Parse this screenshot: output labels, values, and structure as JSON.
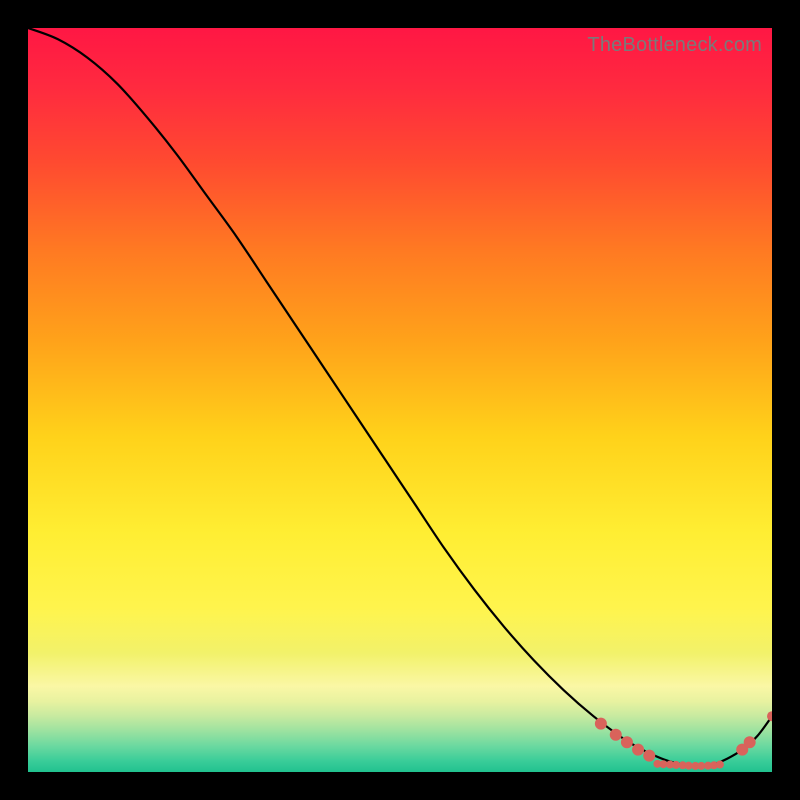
{
  "watermark": "TheBottleneck.com",
  "chart_data": {
    "type": "line",
    "title": "",
    "xlabel": "",
    "ylabel": "",
    "xlim": [
      0,
      100
    ],
    "ylim": [
      0,
      100
    ],
    "grid": false,
    "axes_visible": false,
    "series": [
      {
        "name": "curve",
        "color": "#000000",
        "x": [
          0,
          4,
          8,
          12,
          16,
          20,
          24,
          28,
          32,
          36,
          40,
          44,
          48,
          52,
          56,
          60,
          64,
          68,
          72,
          76,
          80,
          82,
          84,
          86,
          88,
          90,
          92,
          94,
          96,
          98,
          100
        ],
        "y": [
          100,
          98.5,
          96,
          92.5,
          88,
          83,
          77.5,
          72,
          66,
          60,
          54,
          48,
          42,
          36,
          30,
          24.5,
          19.5,
          15,
          11,
          7.5,
          4.5,
          3.3,
          2.3,
          1.5,
          1.0,
          0.8,
          1.0,
          1.8,
          3.0,
          4.8,
          7.5
        ]
      }
    ],
    "markers": [
      {
        "x": 77,
        "y": 6.5,
        "r": 6,
        "color": "#d9635b"
      },
      {
        "x": 79,
        "y": 5.0,
        "r": 6,
        "color": "#d9635b"
      },
      {
        "x": 80.5,
        "y": 4.0,
        "r": 6,
        "color": "#d9635b"
      },
      {
        "x": 82,
        "y": 3.0,
        "r": 6,
        "color": "#d9635b"
      },
      {
        "x": 83.5,
        "y": 2.2,
        "r": 6,
        "color": "#d9635b"
      },
      {
        "x": 84.6,
        "y": 1.1,
        "r": 4,
        "color": "#d9635b"
      },
      {
        "x": 85.4,
        "y": 1.05,
        "r": 4,
        "color": "#d9635b"
      },
      {
        "x": 86.3,
        "y": 1.0,
        "r": 4,
        "color": "#d9635b"
      },
      {
        "x": 87.1,
        "y": 0.95,
        "r": 4,
        "color": "#d9635b"
      },
      {
        "x": 88.0,
        "y": 0.9,
        "r": 4,
        "color": "#d9635b"
      },
      {
        "x": 88.8,
        "y": 0.85,
        "r": 4,
        "color": "#d9635b"
      },
      {
        "x": 89.7,
        "y": 0.82,
        "r": 4,
        "color": "#d9635b"
      },
      {
        "x": 90.5,
        "y": 0.82,
        "r": 4,
        "color": "#d9635b"
      },
      {
        "x": 91.4,
        "y": 0.85,
        "r": 4,
        "color": "#d9635b"
      },
      {
        "x": 92.2,
        "y": 0.9,
        "r": 4,
        "color": "#d9635b"
      },
      {
        "x": 93.0,
        "y": 1.0,
        "r": 4,
        "color": "#d9635b"
      },
      {
        "x": 96.0,
        "y": 3.0,
        "r": 6,
        "color": "#d9635b"
      },
      {
        "x": 97.0,
        "y": 4.0,
        "r": 6,
        "color": "#d9635b"
      },
      {
        "x": 100.0,
        "y": 7.5,
        "r": 5,
        "color": "#d9635b"
      }
    ],
    "gradient_stops": [
      {
        "offset": 0.0,
        "color": "#ff1744"
      },
      {
        "offset": 0.08,
        "color": "#ff2a3f"
      },
      {
        "offset": 0.18,
        "color": "#ff4a30"
      },
      {
        "offset": 0.3,
        "color": "#ff7a22"
      },
      {
        "offset": 0.42,
        "color": "#ffa21a"
      },
      {
        "offset": 0.55,
        "color": "#ffd21a"
      },
      {
        "offset": 0.68,
        "color": "#ffee33"
      },
      {
        "offset": 0.78,
        "color": "#fff44d"
      },
      {
        "offset": 0.84,
        "color": "#f2f26a"
      },
      {
        "offset": 0.885,
        "color": "#faf7a5"
      },
      {
        "offset": 0.905,
        "color": "#e8f2a0"
      },
      {
        "offset": 0.925,
        "color": "#c7eaa0"
      },
      {
        "offset": 0.945,
        "color": "#9be2a0"
      },
      {
        "offset": 0.965,
        "color": "#6bd9a0"
      },
      {
        "offset": 0.985,
        "color": "#3acd99"
      },
      {
        "offset": 1.0,
        "color": "#21c28f"
      }
    ]
  }
}
